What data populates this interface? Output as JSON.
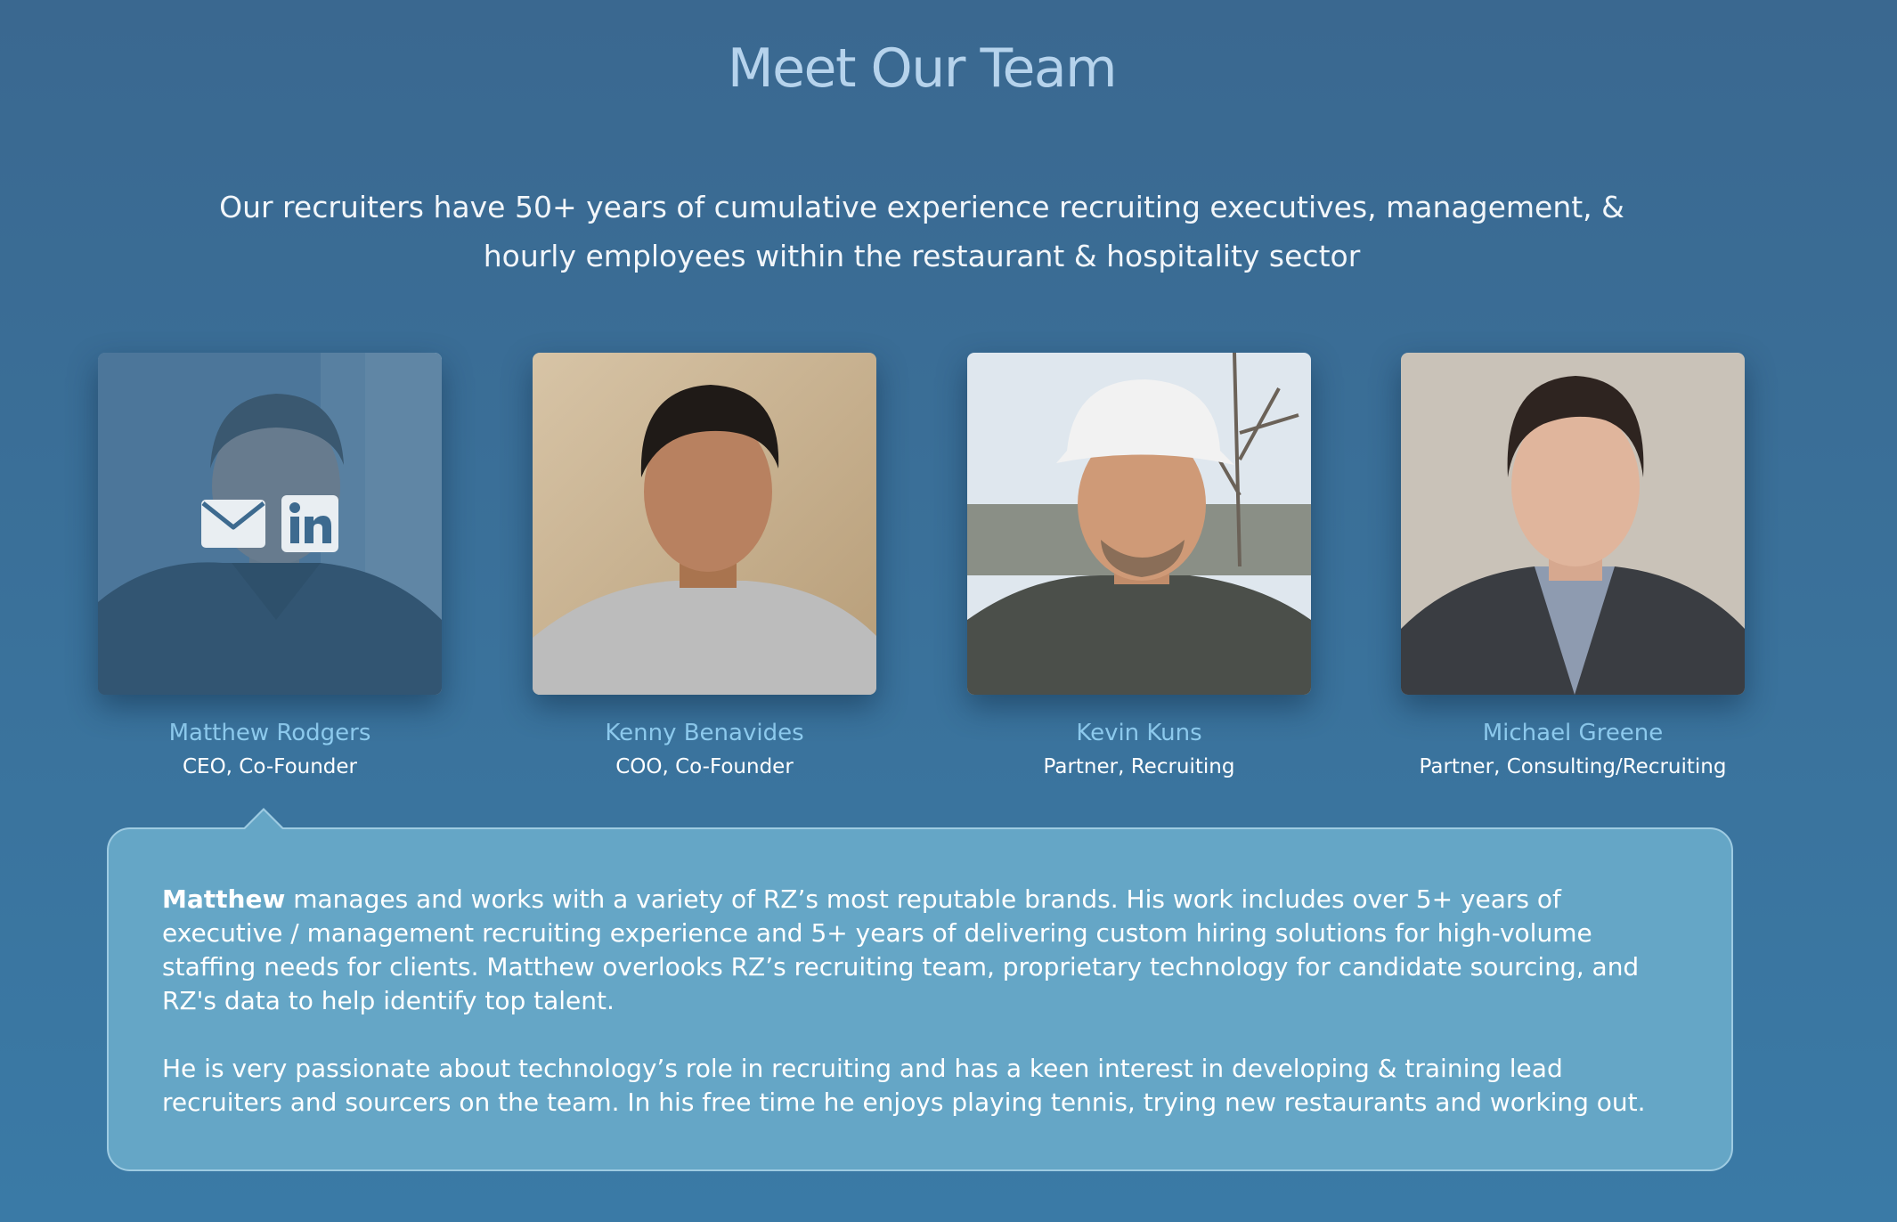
{
  "page": {
    "title": "Meet Our Team",
    "intro": "Our recruiters have 50+ years of cumulative experience recruiting executives, management, & hourly employees within the restaurant & hospitality sector"
  },
  "team": [
    {
      "name": "Matthew Rodgers",
      "role": "CEO, Co-Founder"
    },
    {
      "name": "Kenny Benavides",
      "role": "COO, Co-Founder"
    },
    {
      "name": "Kevin Kuns",
      "role": "Partner, Recruiting"
    },
    {
      "name": "Michael Greene",
      "role": "Partner, Consulting/Recruiting"
    }
  ],
  "bio": {
    "lead_name": "Matthew",
    "paragraph1_rest": " manages and works with a variety of RZ’s most reputable brands. His work includes over 5+ years of executive / management recruiting experience and 5+ years of delivering custom hiring solutions for high-volume staffing needs for clients. Matthew overlooks RZ’s recruiting team, proprietary technology for candidate sourcing, and RZ's data to help identify top talent.",
    "paragraph2": "He is very passionate about technology’s role in recruiting and has a keen interest in developing & training lead recruiters and sourcers on the team. In his free time he enjoys playing tennis, trying new restaurants and working out."
  },
  "icons": {
    "overlay": [
      "email-icon",
      "linkedin-icon"
    ]
  },
  "colors": {
    "background_top": "#3a6890",
    "background_bottom": "#3a7aa6",
    "title": "#b6d3ec",
    "name_accent": "#8fcdf0",
    "bio_panel": "#65a6c6",
    "bio_border": "#9ecbe2"
  }
}
